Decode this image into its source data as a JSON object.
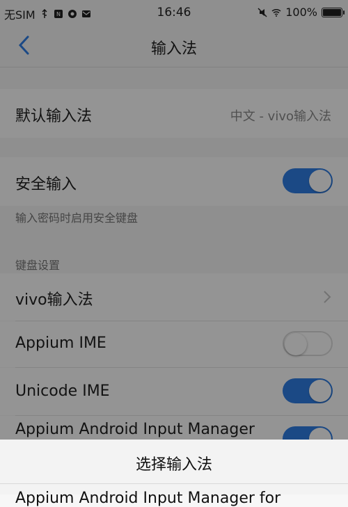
{
  "status_bar": {
    "carrier": "无SIM",
    "time": "16:46",
    "battery": "100%",
    "battery_level": 1.0,
    "icons_left": [
      "usb-icon",
      "notification-icon",
      "app-icon",
      "mail-icon"
    ],
    "icons_right": [
      "mute-icon",
      "wifi-icon",
      "battery-icon"
    ]
  },
  "header": {
    "title": "输入法",
    "back_icon": "chevron-left-icon"
  },
  "default_ime": {
    "label": "默认输入法",
    "value": "中文 - vivo输入法"
  },
  "secure_input": {
    "label": "安全输入",
    "on": true,
    "hint": "输入密码时启用安全键盘"
  },
  "keyboard_section": {
    "title": "键盘设置",
    "items": [
      {
        "label": "vivo输入法",
        "type": "link"
      },
      {
        "label": "Appium IME",
        "type": "toggle",
        "on": false
      },
      {
        "label": "Unicode IME",
        "type": "toggle",
        "on": true
      },
      {
        "label": "Appium Android Input Manager",
        "type": "toggle",
        "on": true
      }
    ]
  },
  "sheet": {
    "title": "选择输入法",
    "partial_item": "Appium Android Input Manager for"
  },
  "colors": {
    "accent": "#2f7ee6",
    "overlay": "rgba(0,0,0,0.42)"
  }
}
